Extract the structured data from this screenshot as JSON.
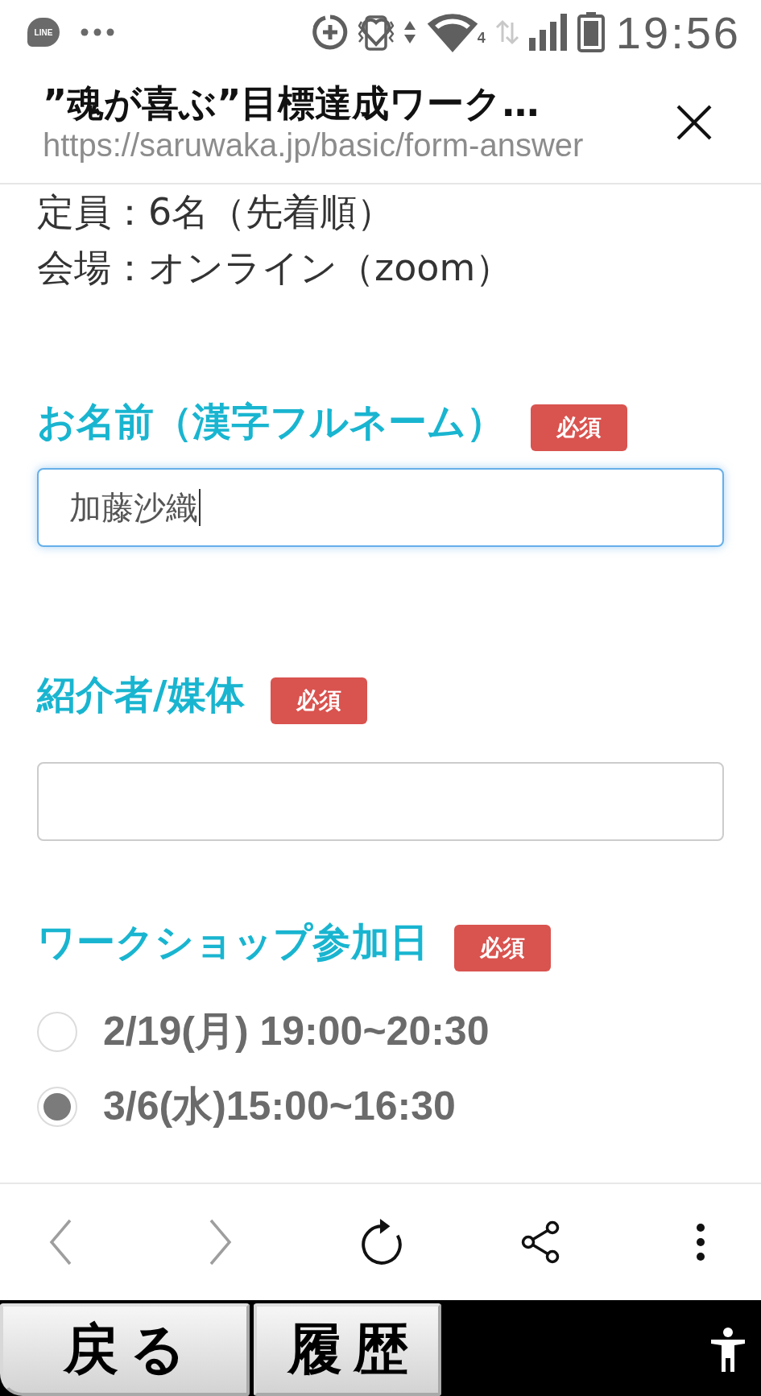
{
  "status_bar": {
    "app_badge": "LINE",
    "network_badge": "4",
    "time": "19:56"
  },
  "browser_header": {
    "title": "”魂が喜ぶ”目標達成ワーク…",
    "url": "https://saruwaka.jp/basic/form-answer"
  },
  "info_lines": [
    "定員：6名（先着順）",
    "会場：オンライン（zoom）"
  ],
  "form": {
    "text_fields": [
      {
        "label": "お名前（漢字フルネーム）",
        "badge": "必須",
        "value": "加藤沙織",
        "focused": true
      },
      {
        "label": "紹介者/媒体",
        "badge": "必須",
        "focused": false
      }
    ],
    "date_choice": {
      "label": "ワークショップ参加日",
      "badge": "必須",
      "options": [
        {
          "label": "2/19(月) 19:00~20:30",
          "selected": false
        },
        {
          "label": "3/6(水)15:00~16:30",
          "selected": true
        }
      ]
    }
  },
  "toolbar": [
    {
      "kind": "back",
      "disabled": true
    },
    {
      "kind": "forward",
      "disabled": true
    },
    {
      "kind": "reload",
      "disabled": false
    },
    {
      "kind": "share",
      "disabled": false
    },
    {
      "kind": "more",
      "disabled": false
    }
  ],
  "system_bar": {
    "buttons": [
      "戻る",
      "履歴"
    ]
  }
}
